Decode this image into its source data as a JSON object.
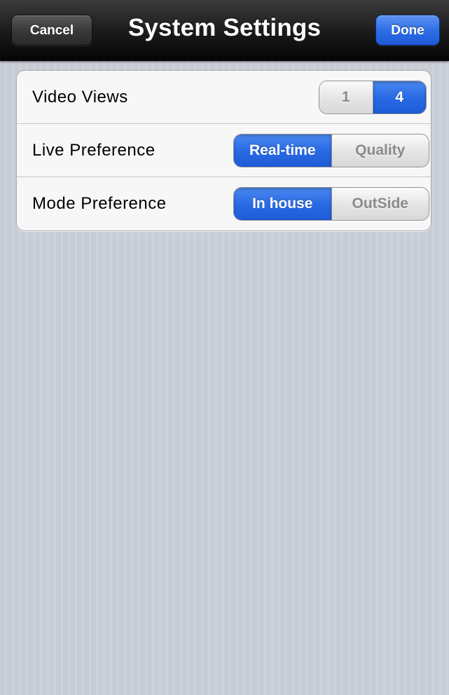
{
  "navbar": {
    "title": "System Settings",
    "cancel_label": "Cancel",
    "done_label": "Done"
  },
  "settings": {
    "rows": [
      {
        "label": "Video Views",
        "options": [
          "1",
          "4"
        ],
        "selected": "4"
      },
      {
        "label": "Live Preference",
        "options": [
          "Real-time",
          "Quality"
        ],
        "selected": "Real-time"
      },
      {
        "label": "Mode Preference",
        "options": [
          "In house",
          "OutSide"
        ],
        "selected": "In house"
      }
    ]
  },
  "colors": {
    "accent": "#2a6ae4",
    "navbar": "#1a1a1a",
    "background": "#c9cdd6"
  }
}
